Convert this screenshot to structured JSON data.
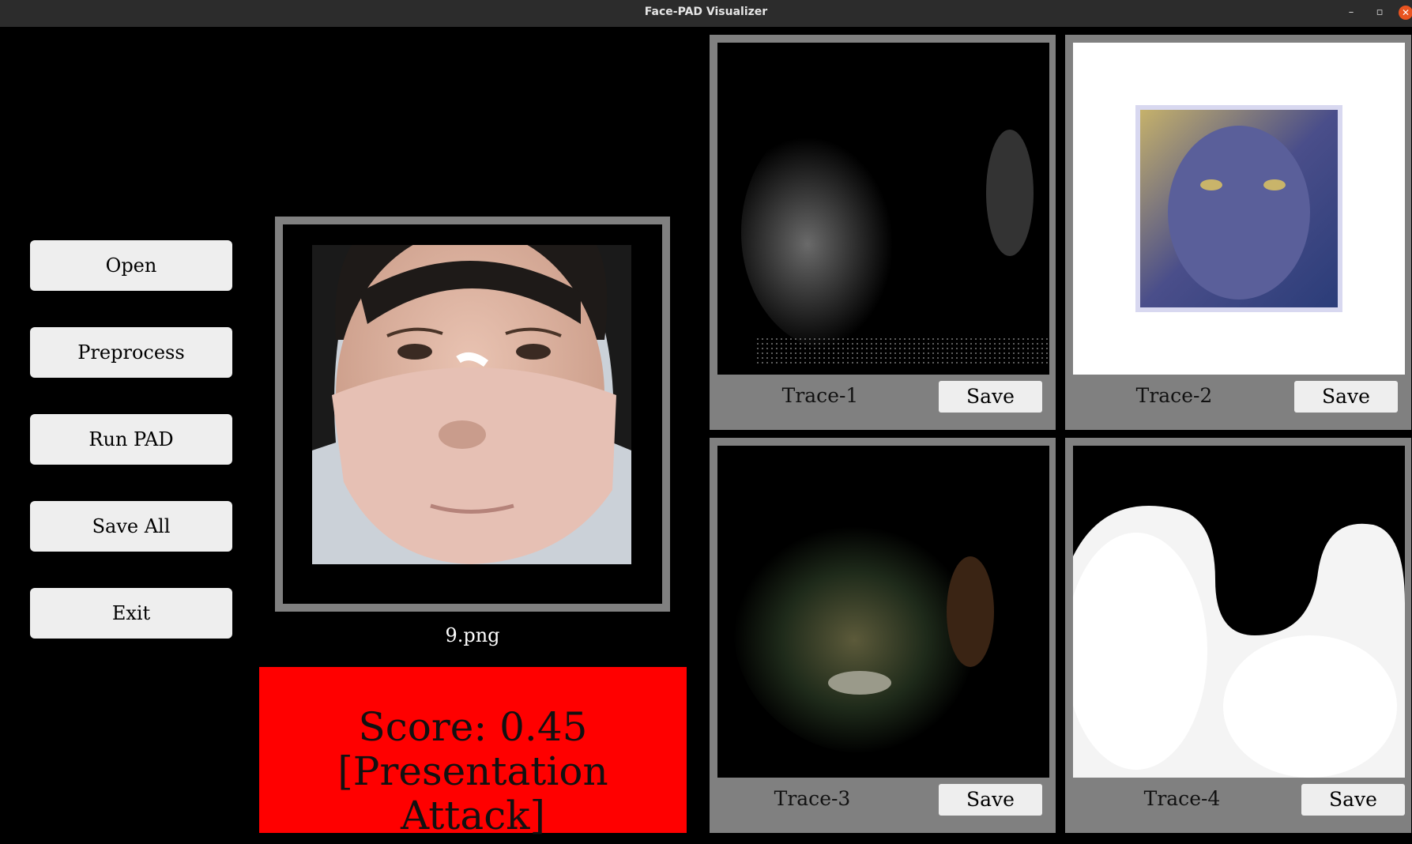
{
  "window": {
    "title": "Face-PAD Visualizer"
  },
  "sidebar": {
    "buttons": [
      "Open",
      "Preprocess",
      "Run PAD",
      "Save All",
      "Exit"
    ]
  },
  "main": {
    "filename": "9.png",
    "score_line": "Score: 0.45",
    "verdict_line": "[Presentation Attack]",
    "score_color": "#ff0000"
  },
  "traces": [
    {
      "label": "Trace-1",
      "save_label": "Save"
    },
    {
      "label": "Trace-2",
      "save_label": "Save"
    },
    {
      "label": "Trace-3",
      "save_label": "Save"
    },
    {
      "label": "Trace-4",
      "save_label": "Save"
    }
  ]
}
